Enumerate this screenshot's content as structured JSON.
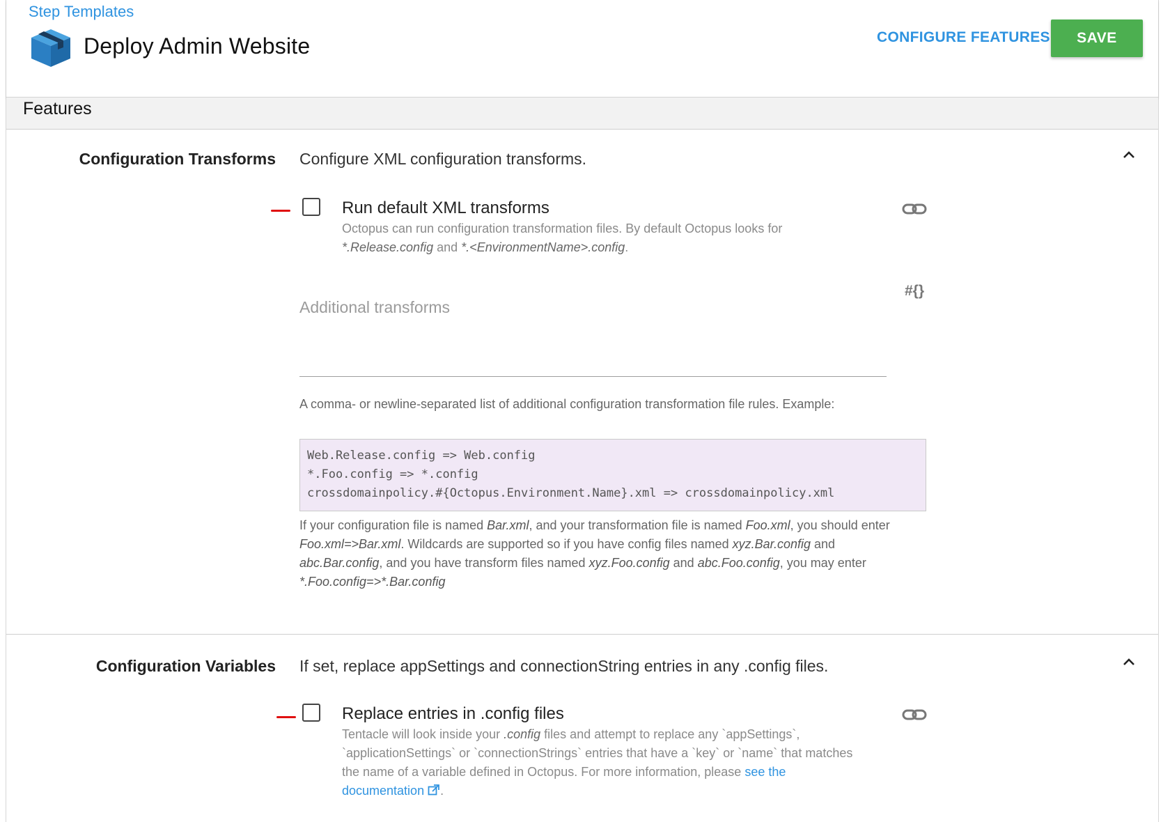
{
  "header": {
    "breadcrumb": "Step Templates",
    "title": "Deploy Admin Website",
    "configure_label": "CONFIGURE FEATURES",
    "save_label": "SAVE"
  },
  "features": {
    "title": "Features"
  },
  "config_transforms": {
    "label": "Configuration Transforms",
    "description": "Configure XML configuration transforms.",
    "checkbox_label": "Run default XML transforms",
    "checkbox_checked": false,
    "help_prefix": "Octopus can run configuration transformation files. By default Octopus looks for",
    "help_file1": "*.Release.config",
    "help_and": "and",
    "help_file2": "*.<EnvironmentName>.config",
    "help_end": ".",
    "additional_placeholder": "Additional transforms",
    "variable_icon": "#{}",
    "list_note": "A comma- or newline-separated list of additional configuration transformation file rules. Example:",
    "code_lines": [
      "Web.Release.config => Web.config",
      "*.Foo.config => *.config",
      "crossdomainpolicy.#{Octopus.Environment.Name}.xml => crossdomainpolicy.xml"
    ],
    "explain": {
      "t1": "If your configuration file is named ",
      "i1": "Bar.xml",
      "t2": ", and your transformation file is named ",
      "i2": "Foo.xml",
      "t3": ", you should enter ",
      "i3": "Foo.xml=>Bar.xml",
      "t4": ". Wildcards are supported so if you have config files named ",
      "i4": "xyz.Bar.config",
      "t5": " and ",
      "i5": "abc.Bar.config",
      "t6": ", and you have transform files named ",
      "i6": "xyz.Foo.config",
      "t7": " and ",
      "i7": "abc.Foo.config",
      "t8": ", you may enter ",
      "i8": "*.Foo.config=>*.Bar.config"
    }
  },
  "config_variables": {
    "label": "Configuration Variables",
    "description": "If set, replace appSettings and connectionString entries in any .config files.",
    "checkbox_label": "Replace entries in .config files",
    "checkbox_checked": false,
    "help_t1": "Tentacle will look inside your ",
    "help_i1": ".config",
    "help_t2": " files and attempt to replace any `appSettings`, `applicationSettings` or `connectionStrings` entries that have a `key` or `name` that matches the name of a variable defined in Octopus. For more information, please ",
    "help_link": "see the documentation",
    "help_end": "."
  },
  "colors": {
    "accent": "#2f93e0",
    "save": "#4caf50",
    "code_bg": "#f1e8f6",
    "annotation_red": "#e01010"
  },
  "icons": [
    "package-icon",
    "chevron-up-icon",
    "link-icon",
    "variable-icon",
    "external-link-icon"
  ]
}
